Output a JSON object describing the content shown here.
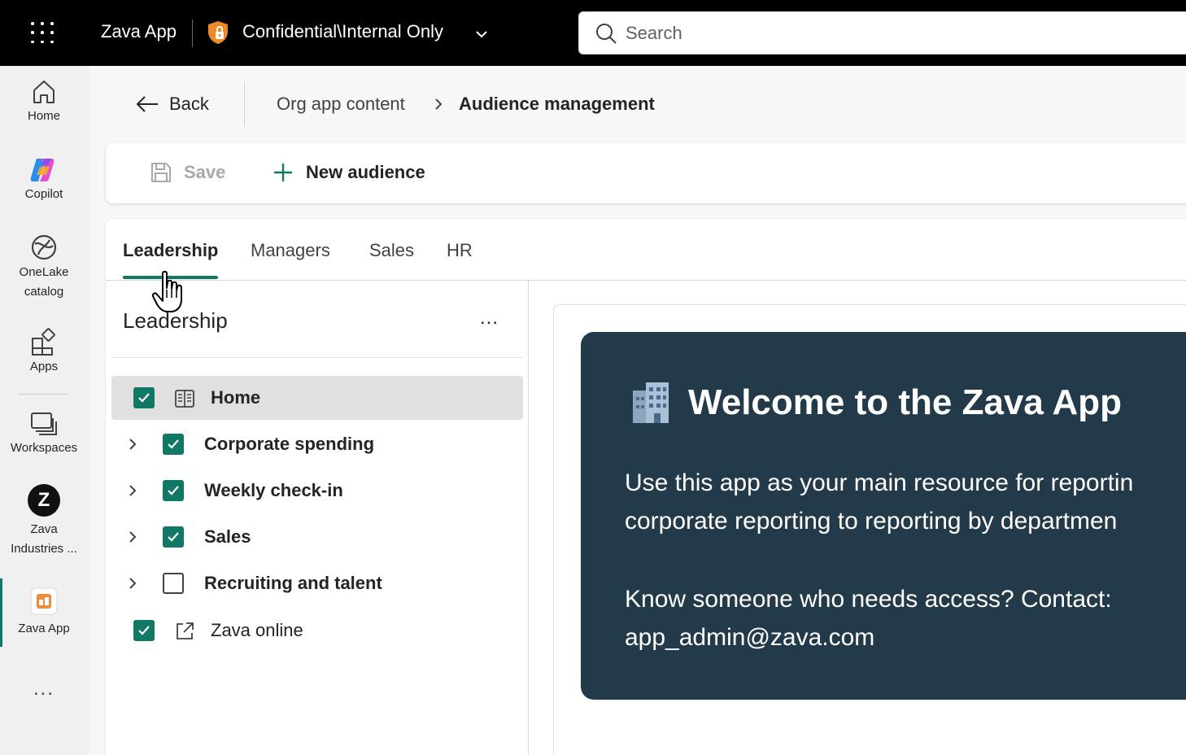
{
  "topbar": {
    "app_title": "Zava App",
    "sensitivity_label": "Confidential\\Internal Only",
    "search_placeholder": "Search",
    "colors": {
      "background": "#000000",
      "shield": "#f08a24"
    }
  },
  "rail": {
    "items": [
      {
        "label": "Home",
        "icon": "home-icon"
      },
      {
        "label": "Copilot",
        "icon": "copilot-icon"
      },
      {
        "label": "OneLake catalog",
        "line1": "OneLake",
        "line2": "catalog",
        "icon": "onelake-icon"
      },
      {
        "label": "Apps",
        "icon": "apps-icon"
      },
      {
        "label": "Workspaces",
        "icon": "workspaces-icon"
      },
      {
        "label": "Zava Industries ...",
        "line1": "Zava",
        "line2": "Industries ...",
        "icon": "zava-workspace-icon",
        "badge": "Z"
      },
      {
        "label": "Zava App",
        "icon": "zava-app-icon",
        "active": true
      }
    ],
    "more": "...",
    "active_color": "#117865"
  },
  "header": {
    "back_label": "Back",
    "breadcrumb": [
      "Org app content",
      "Audience management"
    ]
  },
  "toolbar": {
    "save_label": "Save",
    "new_audience_label": "New audience"
  },
  "tabs": [
    {
      "label": "Leadership",
      "active": true
    },
    {
      "label": "Managers"
    },
    {
      "label": "Sales"
    },
    {
      "label": "HR"
    }
  ],
  "audience_pane": {
    "title": "Leadership",
    "more": "...",
    "items": [
      {
        "label": "Home",
        "checked": true,
        "expandable": false,
        "icon": "report-page-icon",
        "selected": true
      },
      {
        "label": "Corporate spending",
        "checked": true,
        "expandable": true
      },
      {
        "label": "Weekly check-in",
        "checked": true,
        "expandable": true
      },
      {
        "label": "Sales",
        "checked": true,
        "expandable": true
      },
      {
        "label": "Recruiting and talent",
        "checked": false,
        "expandable": true
      },
      {
        "label": "Zava online",
        "checked": true,
        "expandable": false,
        "icon": "external-link-icon"
      }
    ]
  },
  "preview": {
    "emoji": "🏢",
    "title": "Welcome to the Zava App",
    "body_line1": "Use this app as your main resource for reportin",
    "body_line2": "corporate reporting to reporting by departmen",
    "contact_line1": "Know someone who needs access? Contact:",
    "contact_line2": "app_admin@zava.com",
    "background": "#223a4a"
  }
}
